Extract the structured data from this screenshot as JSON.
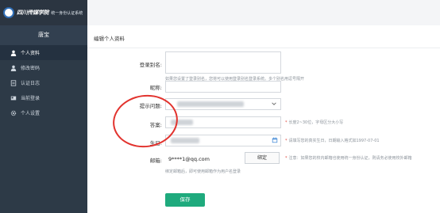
{
  "header": {
    "school_name": "四川传媒学院",
    "system_name": "统一身份认证系统"
  },
  "sidebar": {
    "user_name": "唐宝",
    "items": [
      {
        "label": "个人资料",
        "icon": "user-icon",
        "active": true
      },
      {
        "label": "修改密码",
        "icon": "lock-user-icon",
        "active": false
      },
      {
        "label": "认证日志",
        "icon": "document-icon",
        "active": false
      },
      {
        "label": "当前登录",
        "icon": "login-icon",
        "active": false
      },
      {
        "label": "个人设置",
        "icon": "gear-icon",
        "active": false
      }
    ]
  },
  "main": {
    "title": "编辑个人资料",
    "fields": {
      "login_alias": {
        "label": "登录别名:",
        "hint": "如果您设置了登录别名，您将可以使用登录别名登录系统。多个别名用逗号隔开"
      },
      "nickname": {
        "label": "昵称:"
      },
      "security_question": {
        "label": "提示问题:"
      },
      "answer": {
        "label": "答案:",
        "hint": "长度2~30位，字母区分大小写"
      },
      "birthday": {
        "label": "生日:",
        "hint": "请填写您的真实生日，日期输入格式如1997-07-01"
      },
      "email": {
        "label": "邮箱:",
        "value": "9****1@qq.com",
        "bind_label": "绑定",
        "hint_line1": "注意：如果您的校内邮箱也使用统一身份认证，则请务必使用校外邮箱",
        "hint_line2": "绑定邮箱后，即可使用邮箱作为用户名登录"
      }
    },
    "save_label": "保存"
  },
  "colors": {
    "sidebar_bg": "#2d3a47",
    "accent_green": "#1faa7d",
    "annotation_red": "#e2332e",
    "required_red": "#e0443a"
  }
}
